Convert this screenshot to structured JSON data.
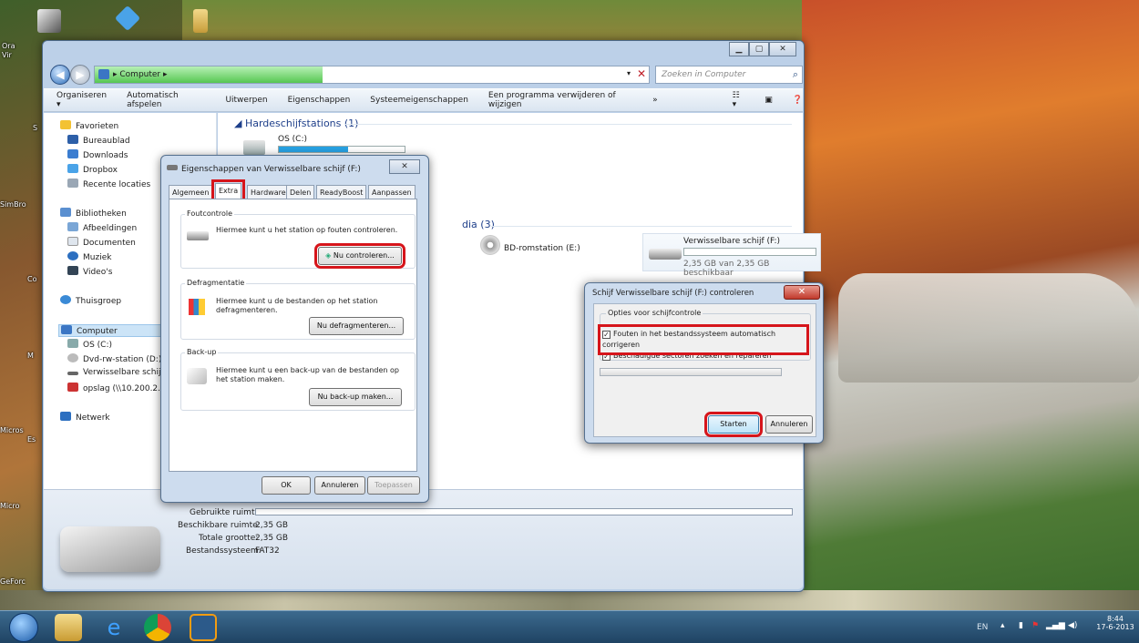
{
  "desktop": {
    "labels": [
      "Ora",
      "Vir",
      "S",
      "SimBro",
      "Co",
      "Co",
      "M",
      "Micros",
      "Es",
      "Micro",
      "GeForc"
    ]
  },
  "explorer": {
    "address": "Computer",
    "search_placeholder": "Zoeken in Computer",
    "toolbar": [
      "Organiseren ▾",
      "Automatisch afspelen",
      "Uitwerpen",
      "Eigenschappen",
      "Systeemeigenschappen",
      "Een programma verwijderen of wijzigen",
      "»"
    ],
    "nav": {
      "favorites_header": "Favorieten",
      "favorites": [
        "Bureaublad",
        "Downloads",
        "Dropbox",
        "Recente locaties"
      ],
      "libraries_header": "Bibliotheken",
      "libraries": [
        "Afbeeldingen",
        "Documenten",
        "Muziek",
        "Video's"
      ],
      "homegroup": "Thuisgroep",
      "computer_header": "Computer",
      "computer": [
        "OS (C:)",
        "Dvd-rw-station (D:)",
        "Verwisselbare schijf (",
        "opslag (\\\\10.200.2.2)"
      ],
      "network": "Netwerk"
    },
    "content": {
      "hdd_section": "Hardeschijfstations (1)",
      "os_drive": "OS (C:)",
      "removable_section": "dia (3)",
      "bd_drive": "BD-romstation (E:)",
      "removable_name": "Verwisselbare schijf (F:)",
      "removable_space": "2,35 GB van 2,35 GB beschikbaar"
    },
    "details": {
      "used_label": "Gebruikte ruimte:",
      "free_label": "Beschikbare ruimte:",
      "free_value": "2,35 GB",
      "total_label": "Totale grootte:",
      "total_value": "2,35 GB",
      "fs_label": "Bestandssysteem:",
      "fs_value": "FAT32"
    }
  },
  "props": {
    "title": "Eigenschappen van Verwisselbare schijf (F:)",
    "tabs": [
      "Algemeen",
      "Extra",
      "Hardware",
      "Delen",
      "ReadyBoost",
      "Aanpassen"
    ],
    "active_tab": "Extra",
    "error_group": "Foutcontrole",
    "error_text": "Hiermee kunt u het station op fouten controleren.",
    "error_button": "Nu controleren...",
    "defrag_group": "Defragmentatie",
    "defrag_text": "Hiermee kunt u de bestanden op het station defragmenteren.",
    "defrag_button": "Nu defragmenteren...",
    "backup_group": "Back-up",
    "backup_text": "Hiermee kunt u een back-up van de bestanden op het station maken.",
    "backup_button": "Nu back-up maken...",
    "ok": "OK",
    "cancel": "Annuleren",
    "apply": "Toepassen"
  },
  "check": {
    "title": "Schijf Verwisselbare schijf (F:) controleren",
    "group": "Opties voor schijfcontrole",
    "option1": "Fouten in het bestandssysteem automatisch corrigeren",
    "option2": "Beschadigde sectoren zoeken en repareren",
    "option1_checked": true,
    "option2_checked": true,
    "start": "Starten",
    "cancel": "Annuleren"
  },
  "taskbar": {
    "lang": "EN",
    "time": "8:44",
    "date": "17-6-2013"
  },
  "colors": {
    "highlight": "#d6151b",
    "link_blue": "#1e3f8a"
  }
}
